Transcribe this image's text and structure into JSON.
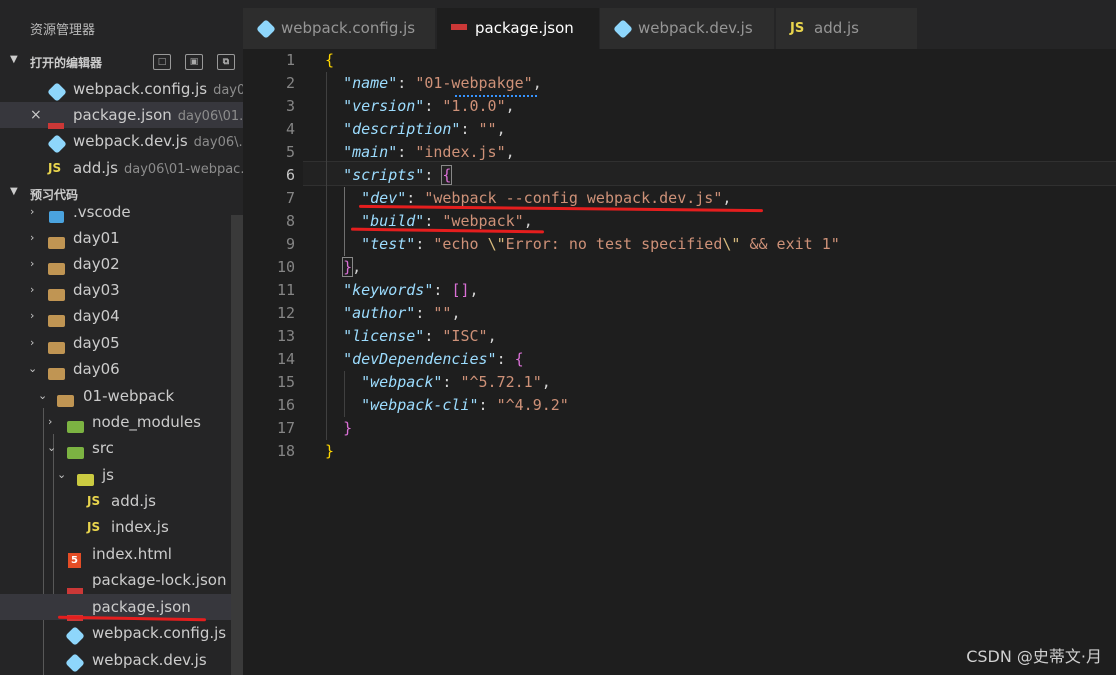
{
  "sidebar": {
    "title": "资源管理器",
    "open_editors": {
      "label": "打开的编辑器",
      "items": [
        {
          "name": "webpack.config.js",
          "desc": "day0..."
        },
        {
          "name": "package.json",
          "desc": "day06\\01..."
        },
        {
          "name": "webpack.dev.js",
          "desc": "day06\\..."
        },
        {
          "name": "add.js",
          "desc": "day06\\01-webpac..."
        }
      ],
      "close_glyph": "×"
    },
    "workspace": {
      "label": "预习代码",
      "tree": [
        {
          "name": ".vscode"
        },
        {
          "name": "day01"
        },
        {
          "name": "day02"
        },
        {
          "name": "day03"
        },
        {
          "name": "day04"
        },
        {
          "name": "day05"
        },
        {
          "name": "day06"
        },
        {
          "name": "01-webpack"
        },
        {
          "name": "node_modules"
        },
        {
          "name": "src"
        },
        {
          "name": "js"
        },
        {
          "name": "add.js"
        },
        {
          "name": "index.js"
        },
        {
          "name": "index.html"
        },
        {
          "name": "package-lock.json"
        },
        {
          "name": "package.json"
        },
        {
          "name": "webpack.config.js"
        },
        {
          "name": "webpack.dev.js"
        }
      ]
    }
  },
  "tabs": [
    {
      "label": "webpack.config.js",
      "icon": "webpack-icon"
    },
    {
      "label": "package.json",
      "icon": "npm-icon",
      "active": true
    },
    {
      "label": "webpack.dev.js",
      "icon": "webpack-icon"
    },
    {
      "label": "add.js",
      "icon": "js-icon"
    }
  ],
  "icons": {
    "js": "JS",
    "html": "5"
  },
  "editor": {
    "current_line": 6,
    "lines": [
      {
        "n": "1"
      },
      {
        "n": "2"
      },
      {
        "n": "3"
      },
      {
        "n": "4"
      },
      {
        "n": "5"
      },
      {
        "n": "6"
      },
      {
        "n": "7"
      },
      {
        "n": "8"
      },
      {
        "n": "9"
      },
      {
        "n": "10"
      },
      {
        "n": "11"
      },
      {
        "n": "12"
      },
      {
        "n": "13"
      },
      {
        "n": "14"
      },
      {
        "n": "15"
      },
      {
        "n": "16"
      },
      {
        "n": "17"
      },
      {
        "n": "18"
      }
    ],
    "tokens": {
      "name_key": "\"name\"",
      "name_val": "\"01-webpakge\"",
      "version_key": "\"version\"",
      "version_val": "\"1.0.0\"",
      "description_key": "\"description\"",
      "description_val": "\"\"",
      "main_key": "\"main\"",
      "main_val": "\"index.js\"",
      "scripts_key": "\"scripts\"",
      "dev_key": "\"dev\"",
      "dev_val": "\"webpack --config webpack.dev.js\"",
      "build_key": "\"build\"",
      "build_val": "\"webpack\"",
      "test_key": "\"test\"",
      "test_val_a": "\"echo ",
      "test_esc1": "\\\"",
      "test_val_b": "Error: no test specified",
      "test_esc2": "\\\"",
      "test_val_c": " && exit 1\"",
      "keywords_key": "\"keywords\"",
      "author_key": "\"author\"",
      "author_val": "\"\"",
      "license_key": "\"license\"",
      "license_val": "\"ISC\"",
      "devdeps_key": "\"devDependencies\"",
      "webpack_key": "\"webpack\"",
      "webpack_val": "\"^5.72.1\"",
      "webpackcli_key": "\"webpack-cli\"",
      "webpackcli_val": "\"^4.9.2\""
    }
  },
  "watermark": "CSDN @史蒂文·月",
  "colors": {
    "accent_red": "#e51e1e",
    "key": "#9cdcfe",
    "string": "#ce9178"
  }
}
